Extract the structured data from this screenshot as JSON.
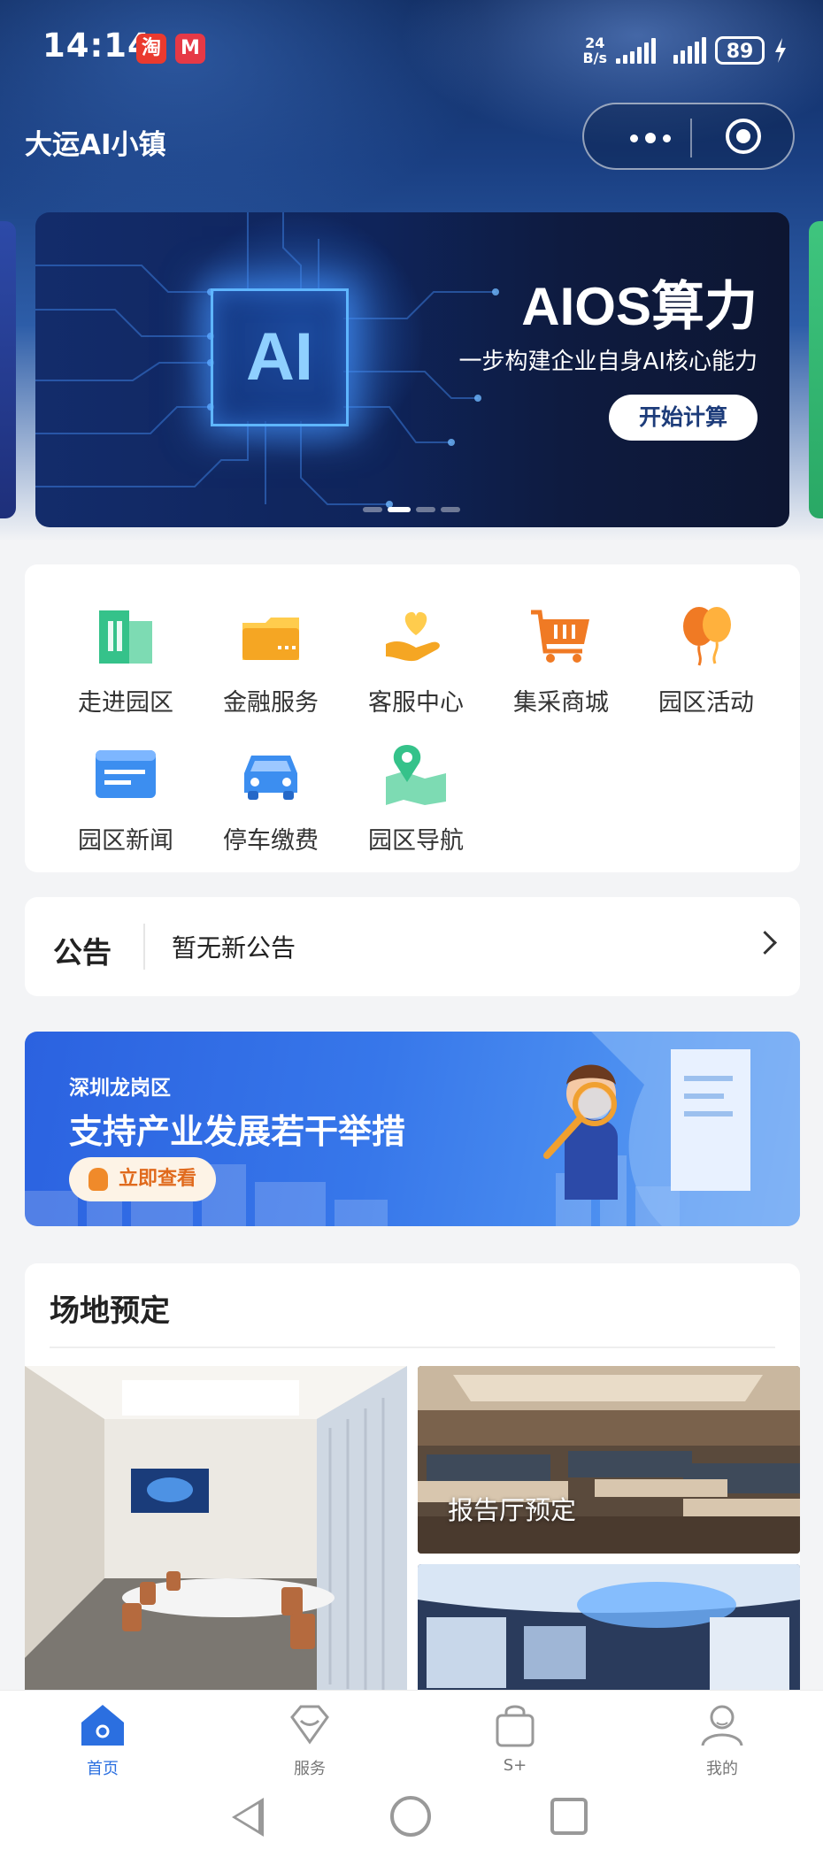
{
  "status_bar": {
    "time": "14:14",
    "app_badge_1": "淘",
    "app_badge_2": "M",
    "net_speed_value": "24",
    "net_speed_unit": "B/s",
    "battery": "89"
  },
  "header": {
    "title": "大运AI小镇"
  },
  "banner": {
    "chip_text": "AI",
    "title": "AIOS算力",
    "subtitle": "一步构建企业自身AI核心能力",
    "button": "开始计算"
  },
  "services": [
    {
      "label": "走进园区",
      "icon": "building-icon",
      "color": "#35c28a"
    },
    {
      "label": "金融服务",
      "icon": "wallet-icon",
      "color": "#f5a623"
    },
    {
      "label": "客服中心",
      "icon": "heart-hand-icon",
      "color": "#f5a623"
    },
    {
      "label": "集采商城",
      "icon": "cart-icon",
      "color": "#f07a24"
    },
    {
      "label": "园区活动",
      "icon": "balloon-icon",
      "color": "#f5a623"
    },
    {
      "label": "园区新闻",
      "icon": "news-icon",
      "color": "#3c8ef0"
    },
    {
      "label": "停车缴费",
      "icon": "car-icon",
      "color": "#3c8ef0"
    },
    {
      "label": "园区导航",
      "icon": "map-pin-icon",
      "color": "#35c28a"
    }
  ],
  "notice": {
    "label": "公告",
    "text": "暂无新公告"
  },
  "promo": {
    "region": "深圳龙岗区",
    "title": "支持产业发展若干举措",
    "button": "立即查看"
  },
  "venue": {
    "title": "场地预定",
    "items": [
      {
        "caption": ""
      },
      {
        "caption": "报告厅预定"
      },
      {
        "caption": ""
      }
    ]
  },
  "tabbar": [
    {
      "label": "首页",
      "icon": "home-icon",
      "active": true
    },
    {
      "label": "服务",
      "icon": "diamond-icon",
      "active": false
    },
    {
      "label": "S+",
      "icon": "bag-icon",
      "active": false
    },
    {
      "label": "我的",
      "icon": "user-icon",
      "active": false
    }
  ],
  "colors": {
    "accent": "#2b6fe0",
    "header_dark": "#0f2a5e",
    "orange": "#f07a24",
    "green": "#35c28a"
  }
}
